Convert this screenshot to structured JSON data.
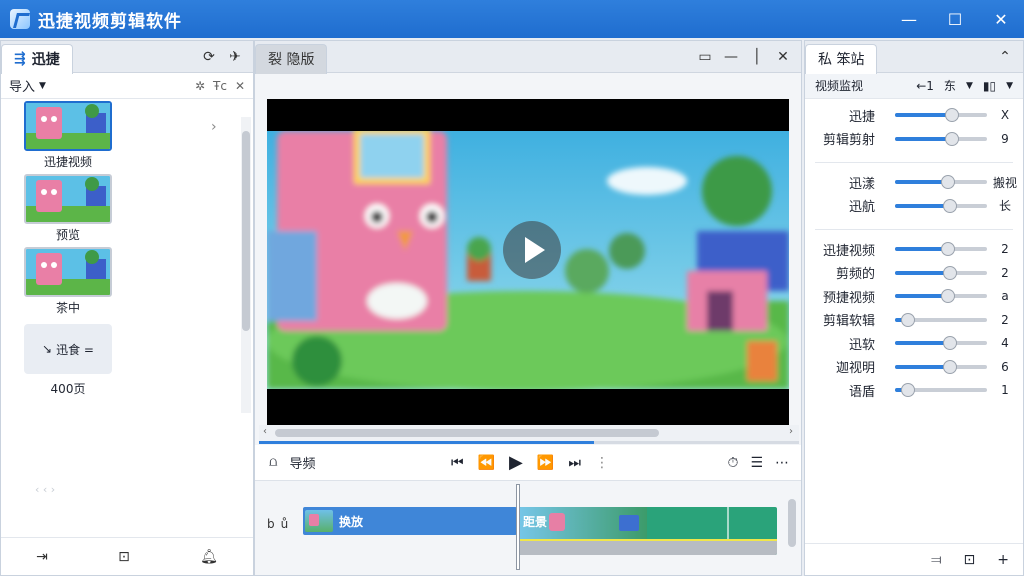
{
  "app": {
    "title": "迅捷视频剪辑软件"
  },
  "window": {
    "minimize": "—",
    "maximize": "☐",
    "close": "✕"
  },
  "left": {
    "tab_label": "迅捷",
    "import_label": "导入",
    "media": [
      {
        "label": "迅捷视频",
        "selected": true
      },
      {
        "label": "预览",
        "selected": false
      },
      {
        "label": "茶中",
        "selected": false
      }
    ],
    "audio_item": {
      "label": "迅食 =",
      "caption": "400页"
    },
    "faint_text": "‹ ‹ ›"
  },
  "center": {
    "tab_label": "裂 隐版",
    "toolbar": {
      "track_label": "导频"
    },
    "clips": {
      "clip_a": "换放",
      "clip_b": "距景"
    },
    "track_ctrls": [
      "b",
      "ů"
    ]
  },
  "right": {
    "tab_label": "私 笨站",
    "header_label": "视频监视",
    "header_value": "←1",
    "header_unit": "东",
    "groups": [
      [
        {
          "label": "迅捷",
          "value": "X",
          "level": 0.62
        },
        {
          "label": "剪辑剪射",
          "value": "9",
          "level": 0.62
        }
      ],
      [
        {
          "label": "迅漾",
          "value": "搬视",
          "level": 0.58
        },
        {
          "label": "迅航",
          "value": "长",
          "level": 0.6
        }
      ],
      [
        {
          "label": "迅捷视频",
          "value": "2",
          "level": 0.58
        },
        {
          "label": "剪频的",
          "value": "2",
          "level": 0.6
        },
        {
          "label": "预捷视频",
          "value": "a",
          "level": 0.58
        },
        {
          "label": "剪辑软辑",
          "value": "2",
          "level": 0.14
        },
        {
          "label": "迅软",
          "value": "4",
          "level": 0.6
        },
        {
          "label": "迦视明",
          "value": "6",
          "level": 0.6
        },
        {
          "label": "语盾",
          "value": "1",
          "level": 0.14
        }
      ]
    ]
  },
  "colors": {
    "accent": "#2f7fdc",
    "title_bar": "#1f6dcf",
    "clip_blue": "#3f86d8",
    "clip_green": "#2aa37a"
  }
}
